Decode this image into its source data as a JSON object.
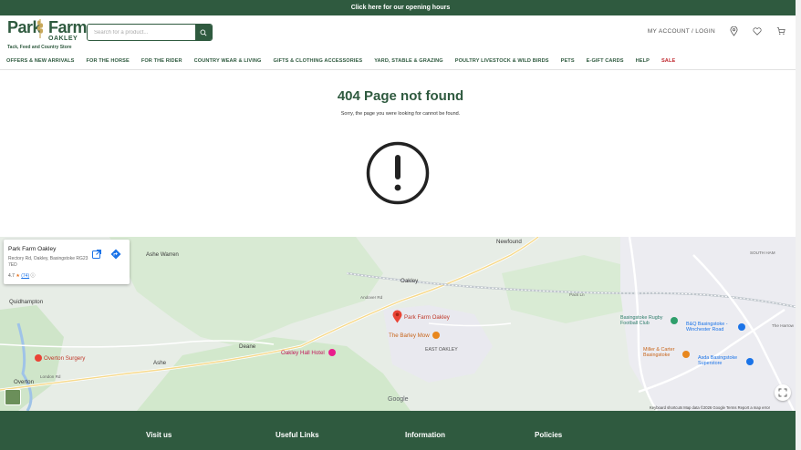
{
  "topbar": {
    "text": "Click here for our opening hours"
  },
  "logo": {
    "line1a": "Park",
    "line1b": "Farm",
    "line2": "OAKLEY",
    "tagline": "Tack, Feed and Country Store"
  },
  "search": {
    "placeholder": "Search for a product..."
  },
  "header_right": {
    "account": "MY ACCOUNT / LOGIN"
  },
  "nav": {
    "items": [
      "OFFERS & NEW ARRIVALS",
      "FOR THE HORSE",
      "FOR THE RIDER",
      "COUNTRY WEAR & LIVING",
      "GIFTS & CLOTHING ACCESSORIES",
      "YARD, STABLE & GRAZING",
      "POULTRY LIVESTOCK & WILD BIRDS",
      "PETS",
      "E-GIFT CARDS",
      "HELP",
      "SALE"
    ]
  },
  "error": {
    "title": "404 Page not found",
    "message": "Sorry, the page you were looking for cannot be found."
  },
  "map": {
    "card": {
      "title": "Park Farm Oakley",
      "address": "Rectory Rd, Oakley, Basingstoke RG23 7ED",
      "rating": "4.7",
      "reviews": "(74)"
    },
    "labels": {
      "newfound": "Newfound",
      "ashe_warren": "Ashe Warren",
      "oakley": "Oakley",
      "quidhampton": "Quidhampton",
      "deane": "Deane",
      "ashe": "Ashe",
      "overton": "Overton",
      "east_oakley": "EAST OAKLEY",
      "south_ham": "SOUTH HAM",
      "the_harrow": "The Harrow",
      "park_farm": "Park Farm Oakley",
      "barley_mow": "The Barley Mow",
      "oakley_hall": "Oakley Hall Hotel",
      "overton_surgery": "Overton Surgery",
      "rugby_club": "Basingstoke Rugby Football Club",
      "bq": "B&Q Basingstoke - Winchester Road",
      "miller_carter": "Miller & Carter Basingstoke",
      "asda": "Asda Basingstoke Superstore",
      "andover_rd": "Andover Rd",
      "pack_ln": "Pack Ln",
      "london_rd": "London Rd",
      "google": "Google",
      "attribution": "Keyboard shortcuts   Map data ©2026 Google   Terms   Report a map error"
    }
  },
  "footer": {
    "columns": [
      "Visit us",
      "Useful Links",
      "Information",
      "Policies"
    ]
  },
  "colors": {
    "brand": "#2f5a3f",
    "sale": "#c0292f"
  }
}
